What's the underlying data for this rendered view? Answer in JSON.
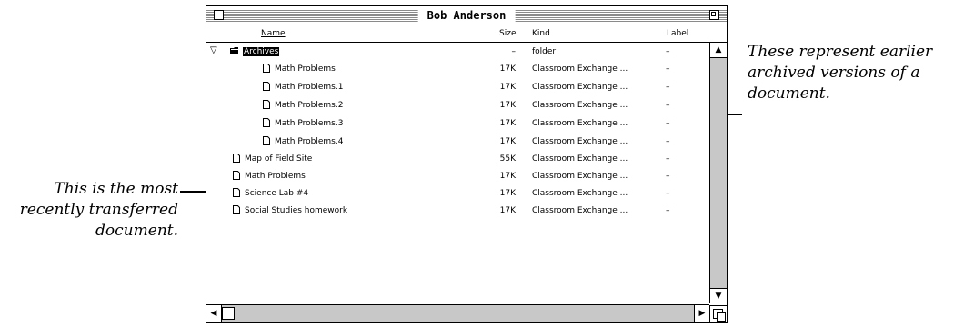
{
  "window": {
    "title": "Bob Anderson"
  },
  "columns": {
    "name": "Name",
    "size": "Size",
    "kind": "Kind",
    "label": "Label"
  },
  "rows": [
    {
      "name": "Archives",
      "size": "–",
      "kind": "folder",
      "label": "–",
      "icon": "folder-icon",
      "expanded": true,
      "selected": true
    },
    {
      "name": "Math Problems",
      "size": "17K",
      "kind": "Classroom Exchange ...",
      "label": "–",
      "icon": "document-icon"
    },
    {
      "name": "Math Problems.1",
      "size": "17K",
      "kind": "Classroom Exchange ...",
      "label": "–",
      "icon": "document-icon"
    },
    {
      "name": "Math Problems.2",
      "size": "17K",
      "kind": "Classroom Exchange ...",
      "label": "–",
      "icon": "document-icon"
    },
    {
      "name": "Math Problems.3",
      "size": "17K",
      "kind": "Classroom Exchange ...",
      "label": "–",
      "icon": "document-icon"
    },
    {
      "name": "Math Problems.4",
      "size": "17K",
      "kind": "Classroom Exchange ...",
      "label": "–",
      "icon": "document-icon"
    },
    {
      "name": "Map of Field Site",
      "size": "55K",
      "kind": "Classroom Exchange ...",
      "label": "–",
      "icon": "document-icon"
    },
    {
      "name": "Math Problems",
      "size": "17K",
      "kind": "Classroom Exchange ...",
      "label": "–",
      "icon": "document-icon"
    },
    {
      "name": "Science Lab #4",
      "size": "17K",
      "kind": "Classroom Exchange ...",
      "label": "–",
      "icon": "document-icon"
    },
    {
      "name": "Social Studies homework",
      "size": "17K",
      "kind": "Classroom Exchange ...",
      "label": "–",
      "icon": "document-icon"
    }
  ],
  "annotations": {
    "right": "These represent earlier archived versions of a document.",
    "left": "This is the most recently transferred document."
  }
}
